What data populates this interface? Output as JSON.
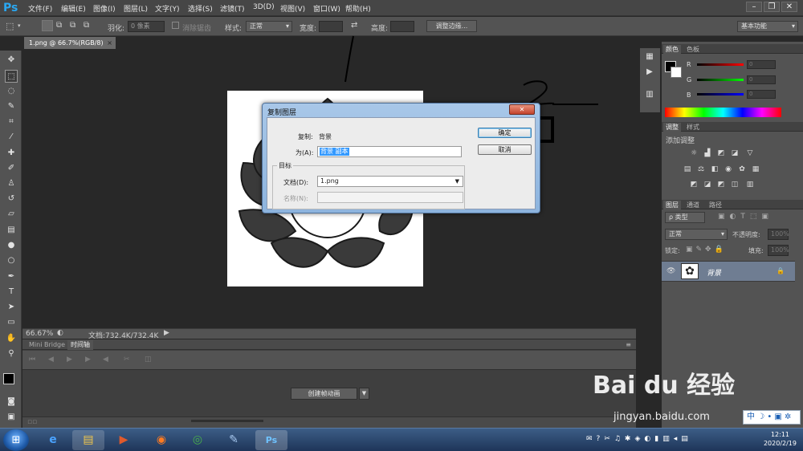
{
  "app": {
    "logo": "Ps"
  },
  "menu": [
    "文件(F)",
    "编辑(E)",
    "图像(I)",
    "图层(L)",
    "文字(Y)",
    "选择(S)",
    "滤镜(T)",
    "3D(D)",
    "视图(V)",
    "窗口(W)",
    "帮助(H)"
  ],
  "window_controls": {
    "minimize": "–",
    "restore": "❐",
    "close": "✕"
  },
  "options": {
    "feather_label": "羽化:",
    "feather_value": "0 像素",
    "antialias_label": "消除锯齿",
    "style_label": "样式:",
    "style_value": "正常",
    "width_label": "宽度:",
    "height_label": "高度:",
    "refine_edge": "调整边缘...",
    "workspace": "基本功能"
  },
  "document": {
    "tab": "1.png @ 66.7%(RGB/8)",
    "zoom": "66.67%",
    "doc_size": "文档:732.4K/732.4K"
  },
  "timeline": {
    "tab_bridge": "Mini Bridge",
    "tab_timeline": "时间轴",
    "create_button": "创建帧动画"
  },
  "panels": {
    "color_tab": "颜色",
    "swatches_tab": "色板",
    "r": "R",
    "g": "G",
    "b": "B",
    "r_val": "0",
    "g_val": "0",
    "b_val": "0",
    "adjust_tab": "调整",
    "styles_tab": "样式",
    "add_adjust": "添加调整",
    "layers_tab": "图层",
    "channels_tab": "通道",
    "paths_tab": "路径",
    "kind": "ρ 类型",
    "blend_mode": "正常",
    "opacity_label": "不透明度:",
    "opacity_value": "100%",
    "lock_label": "锁定:",
    "fill_label": "填充:",
    "fill_value": "100%",
    "layer_name": "背景"
  },
  "dialog": {
    "title": "复制图层",
    "dup_label": "复制:",
    "dup_value": "背景",
    "as_label": "为(A):",
    "as_value": "背景 副本",
    "target_label": "目标",
    "doc_label": "文档(D):",
    "doc_value": "1.png",
    "name_label": "名称(N):",
    "ok": "确定",
    "cancel": "取消"
  },
  "annotations": {
    "mark1": "1",
    "mark2": "2"
  },
  "watermark": {
    "brand": "Bai du 经验",
    "url": "jingyan.baidu.com"
  },
  "ime": {
    "label": "中"
  },
  "clock": {
    "time": "12:11",
    "date": "2020/2/19"
  },
  "colors": {
    "ps_bg": "#535353",
    "canvas": "#282828",
    "selection": "#3399ff",
    "layer_selected": "#6f7d92"
  },
  "icons": [
    "marquee-icon",
    "lasso-icon",
    "brush-icon",
    "text-icon",
    "hand-icon",
    "zoom-icon",
    "ie-icon",
    "firefox-icon",
    "chrome-icon",
    "photoshop-icon"
  ]
}
